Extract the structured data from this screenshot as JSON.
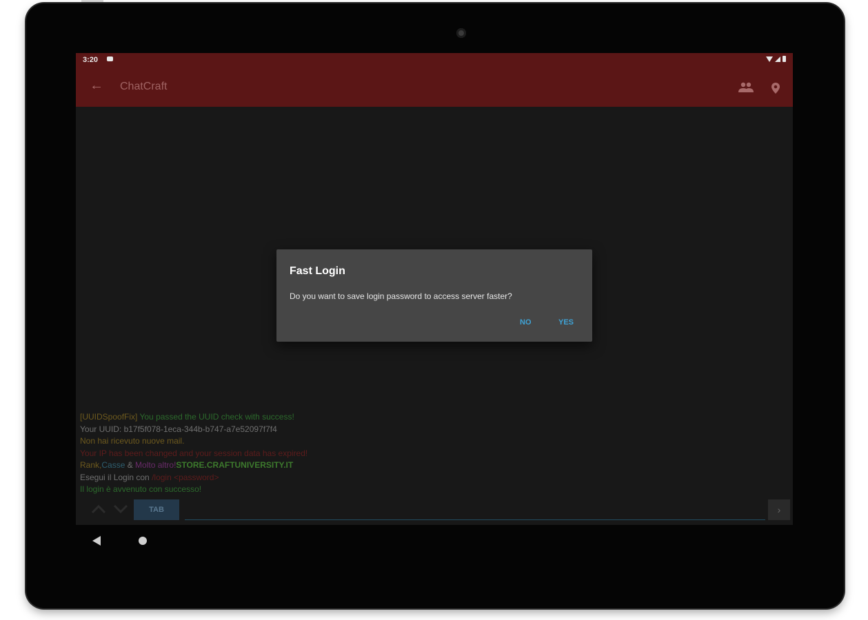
{
  "status_bar": {
    "time": "3:20"
  },
  "app_bar": {
    "title": "ChatCraft",
    "icons": [
      "back-arrow-icon",
      "people-icon",
      "location-pin-icon"
    ]
  },
  "chat": [
    {
      "segments": [
        {
          "text": "[UUIDSpoofFix] ",
          "color": "gold"
        },
        {
          "text": "You passed the UUID check with success!",
          "color": "green"
        }
      ]
    },
    {
      "segments": [
        {
          "text": "Your UUID: b17f5f078-1eca-344b-b747-a7e52097f7f4",
          "color": "gray"
        }
      ]
    },
    {
      "segments": [
        {
          "text": "Non hai ricevuto nuove mail.",
          "color": "gold"
        }
      ]
    },
    {
      "segments": [
        {
          "text": "Your IP has been changed and your session data has expired!",
          "color": "red"
        }
      ]
    },
    {
      "segments": [
        {
          "text": "Rank,",
          "color": "gold"
        },
        {
          "text": "Casse",
          "color": "blue"
        },
        {
          "text": " & ",
          "color": "gray"
        },
        {
          "text": "Molto altro!",
          "color": "purple"
        },
        {
          "text": "STORE.CRAFTUNIVERSITY.IT",
          "color": "bright"
        }
      ]
    },
    {
      "segments": [
        {
          "text": "Esegui il Login con ",
          "color": "gray"
        },
        {
          "text": "/login <password>",
          "color": "red"
        }
      ]
    },
    {
      "segments": [
        {
          "text": "Il login è avvenuto con successo!",
          "color": "green"
        }
      ]
    }
  ],
  "input": {
    "tab_label": "TAB",
    "value": "",
    "send_icon": "chevron-right-icon"
  },
  "dialog": {
    "title": "Fast Login",
    "message": "Do you want to save login password to access server faster?",
    "no_label": "NO",
    "yes_label": "YES"
  },
  "colors": {
    "appbar": "#5b1616",
    "accent": "#3fa3d6",
    "dialog_bg": "#464646"
  }
}
